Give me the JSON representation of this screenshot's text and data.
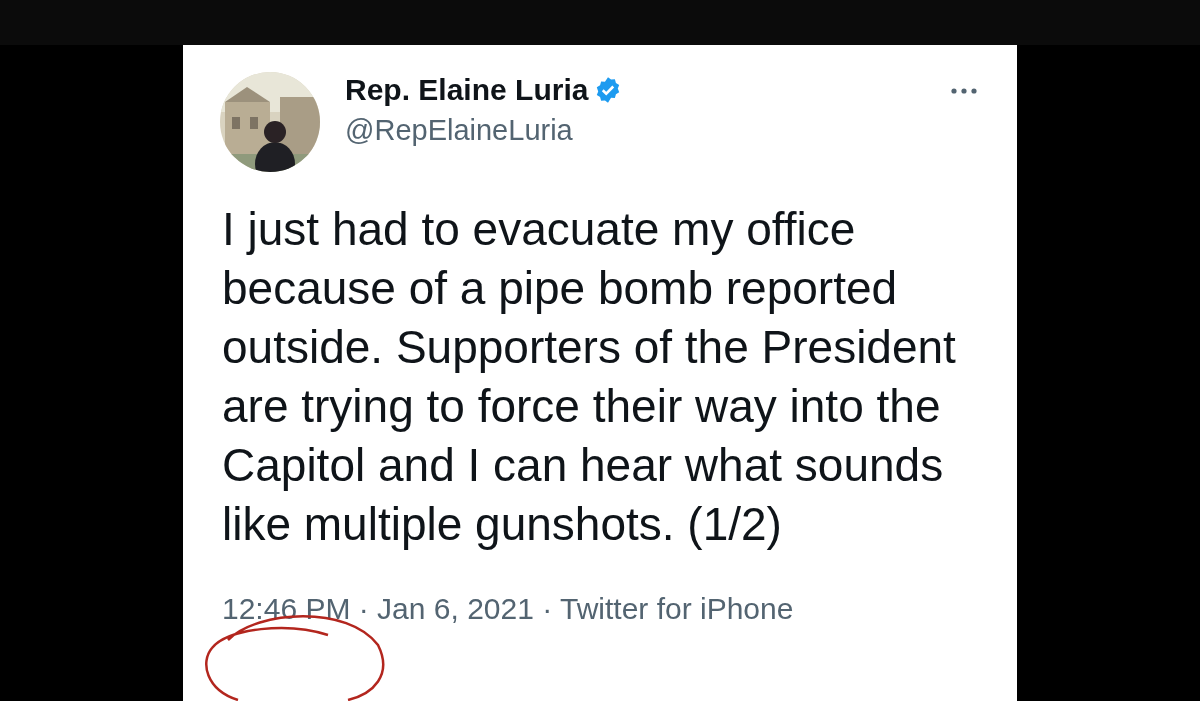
{
  "tweet": {
    "author": {
      "name": "Rep. Elaine Luria",
      "handle": "@RepElaineLuria",
      "verified": true
    },
    "text": "I just had to evacuate my office because of a pipe bomb reported outside. Supporters of the President are trying to force their way into the Capitol and I can hear what sounds like multiple gunshots. (1/2)",
    "meta": "12:46 PM · Jan 6, 2021 · Twitter for iPhone",
    "annotation": {
      "kind": "circle",
      "color": "#b3261e"
    }
  }
}
